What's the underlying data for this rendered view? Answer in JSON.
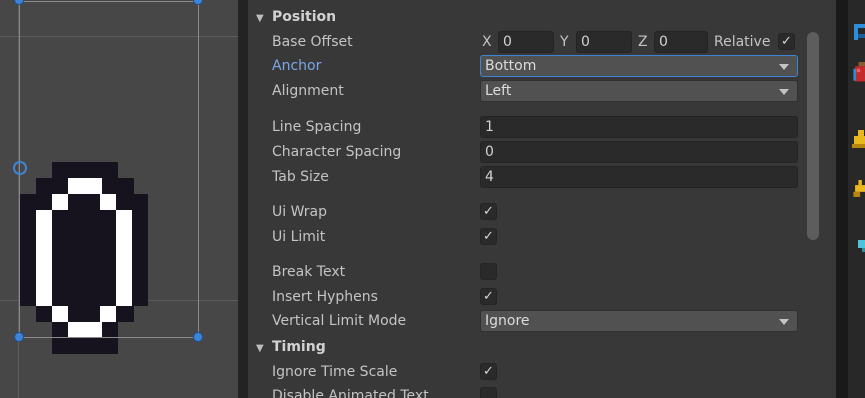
{
  "sections": {
    "position": "Position",
    "timing": "Timing"
  },
  "fields": {
    "base_offset": {
      "label": "Base Offset",
      "x_label": "X",
      "x": "0",
      "y_label": "Y",
      "y": "0",
      "z_label": "Z",
      "z": "0",
      "relative_label": "Relative",
      "relative_checked": true
    },
    "anchor": {
      "label": "Anchor",
      "value": "Bottom"
    },
    "alignment": {
      "label": "Alignment",
      "value": "Left"
    },
    "line_spacing": {
      "label": "Line Spacing",
      "value": "1"
    },
    "character_spacing": {
      "label": "Character Spacing",
      "value": "0"
    },
    "tab_size": {
      "label": "Tab Size",
      "value": "4"
    },
    "ui_wrap": {
      "label": "Ui Wrap",
      "checked": true
    },
    "ui_limit": {
      "label": "Ui Limit",
      "checked": true
    },
    "break_text": {
      "label": "Break Text",
      "checked": false
    },
    "insert_hyphens": {
      "label": "Insert Hyphens",
      "checked": true
    },
    "vertical_limit_mode": {
      "label": "Vertical Limit Mode",
      "value": "Ignore"
    },
    "ignore_time_scale": {
      "label": "Ignore Time Scale",
      "checked": true
    },
    "disable_animated_text": {
      "label": "Disable Animated Text",
      "checked": false
    }
  },
  "checkmark_glyph": "✓",
  "icons": {
    "scene_glyph": "pixel-zero-glyph",
    "rail": [
      "blue-pixel-icon",
      "red-potion-icon",
      "yellow-bell-icon",
      "yellow-bird-icon",
      "cyan-pixel-icon"
    ]
  },
  "colors": {
    "accent": "#3d84d6",
    "anchor_label": "#7ca8e6",
    "inspector_bg": "#383838",
    "scene_bg": "#474747"
  }
}
